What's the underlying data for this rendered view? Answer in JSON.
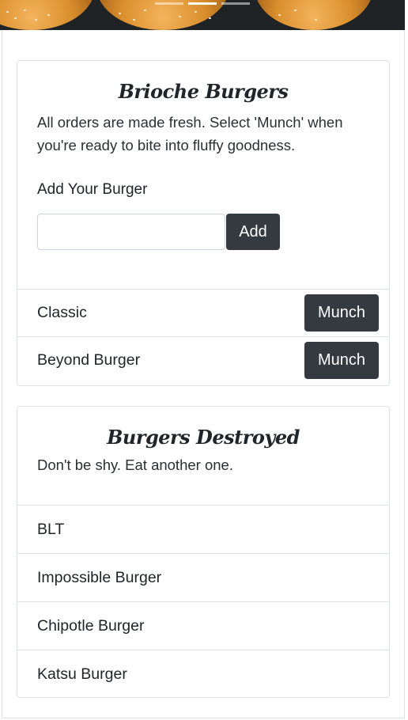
{
  "carousel": {
    "slides": 3,
    "active_index": 1
  },
  "brioche": {
    "title": "Brioche Burgers",
    "description": "All orders are made fresh. Select 'Munch' when you're ready to bite into fluffy goodness.",
    "add_label": "Add Your Burger",
    "input_value": "",
    "add_button": "Add",
    "burgers": [
      {
        "name": "Classic",
        "action": "Munch"
      },
      {
        "name": "Beyond Burger",
        "action": "Munch"
      }
    ]
  },
  "destroyed": {
    "title": "Burgers Destroyed",
    "description": "Don't be shy. Eat another one.",
    "burgers": [
      {
        "name": "BLT"
      },
      {
        "name": "Impossible Burger"
      },
      {
        "name": "Chipotle Burger"
      },
      {
        "name": "Katsu Burger"
      }
    ]
  },
  "colors": {
    "button_dark": "#343a40",
    "border": "#dfe2e6"
  }
}
